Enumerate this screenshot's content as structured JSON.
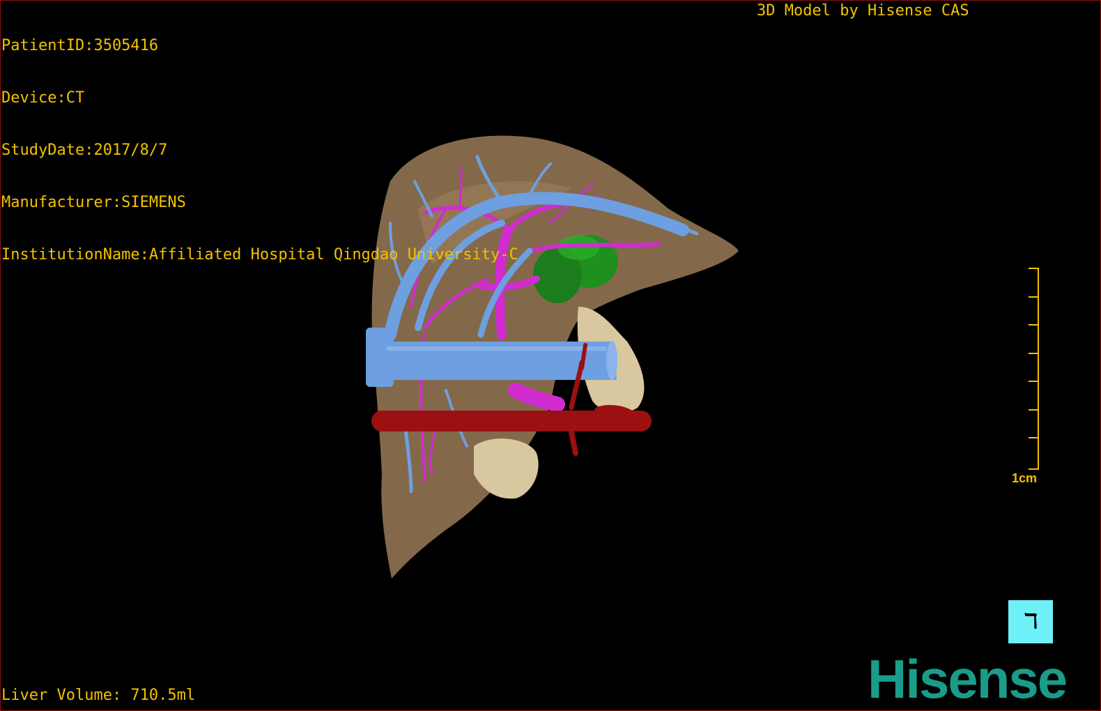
{
  "info": {
    "patient_id": "PatientID:3505416",
    "device": "Device:CT",
    "study_date": "StudyDate:2017/8/7",
    "manufacturer": "Manufacturer:SIEMENS",
    "institution": "InstitutionName:Affiliated Hospital Qingdao University-C"
  },
  "brand_label": "3D Model by Hisense CAS",
  "volume_label": "Liver Volume: 710.5ml",
  "scale": {
    "label": "1cm",
    "ticks": 8
  },
  "orientation_button": {
    "icon": "orientation-posterior-icon",
    "glyph": "ℸ"
  },
  "logo": "Hisense",
  "colors": {
    "overlay_text": "#f2c200",
    "liver": "#8a6f4e",
    "hepatic_vein": "#6e9fe0",
    "portal_vein": "#d12cd0",
    "artery": "#9b1111",
    "gallbladder": "#1f8f1f",
    "bone": "#d9c7a0",
    "orientation_button": "#6ff0f7",
    "logo": "#1b9c8a",
    "frame": "#8a1111"
  }
}
